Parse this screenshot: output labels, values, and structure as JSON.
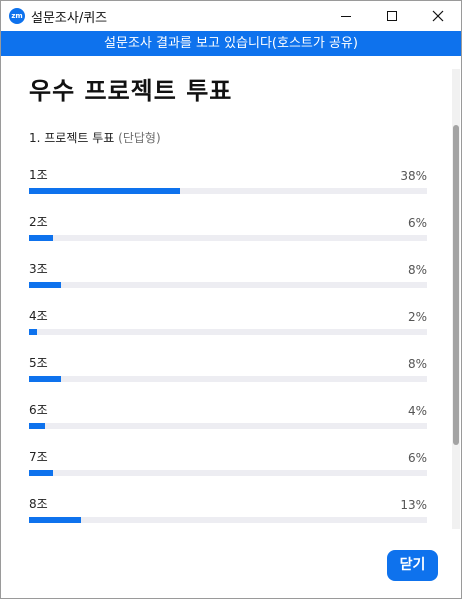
{
  "window": {
    "app_icon_text": "zm",
    "title": "설문조사/퀴즈"
  },
  "banner": {
    "text": "설문조사 결과를 보고 있습니다(호스트가 공유)"
  },
  "poll": {
    "title": "우수 프로젝트 투표",
    "question": "1. 프로젝트 투표",
    "question_type": "(단답형)",
    "results": [
      {
        "label": "1조",
        "percent_text": "38%",
        "percent": 38
      },
      {
        "label": "2조",
        "percent_text": "6%",
        "percent": 6
      },
      {
        "label": "3조",
        "percent_text": "8%",
        "percent": 8
      },
      {
        "label": "4조",
        "percent_text": "2%",
        "percent": 2
      },
      {
        "label": "5조",
        "percent_text": "8%",
        "percent": 8
      },
      {
        "label": "6조",
        "percent_text": "4%",
        "percent": 4
      },
      {
        "label": "7조",
        "percent_text": "6%",
        "percent": 6
      },
      {
        "label": "8조",
        "percent_text": "13%",
        "percent": 13
      }
    ]
  },
  "footer": {
    "close_label": "닫기"
  },
  "colors": {
    "accent": "#0e72ed",
    "track": "#ededf2"
  }
}
